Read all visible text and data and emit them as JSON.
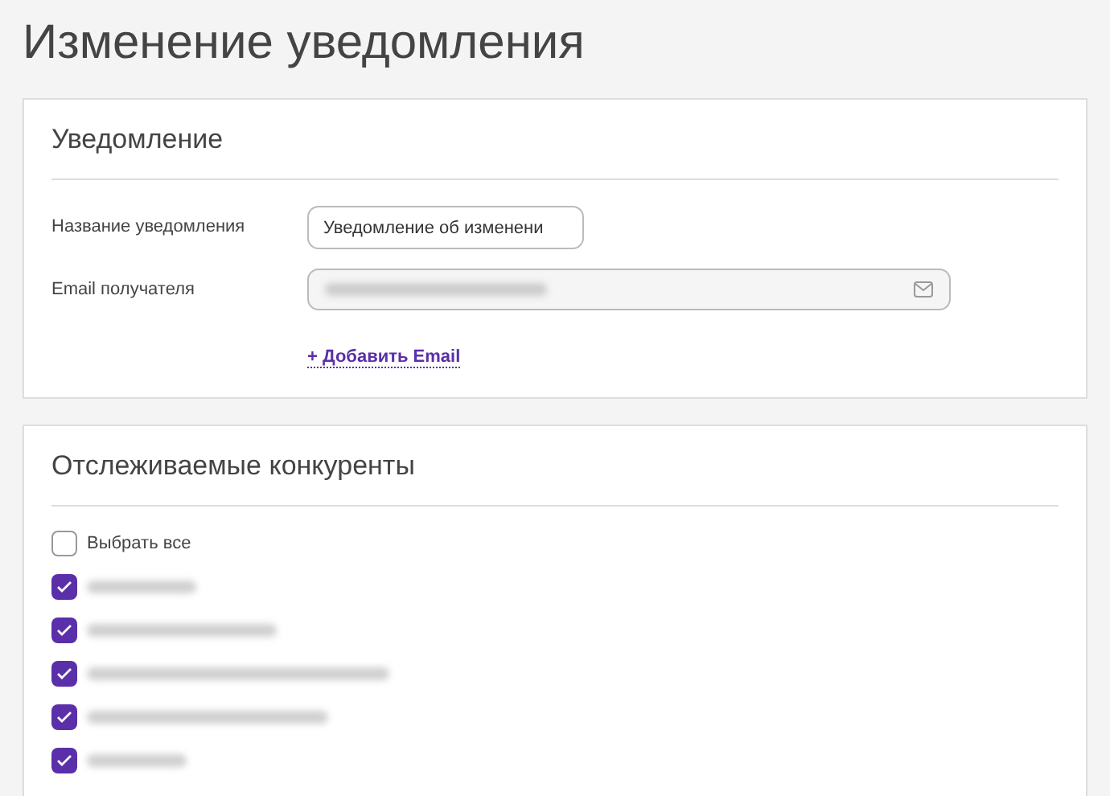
{
  "page_title": "Изменение уведомления",
  "notification": {
    "heading": "Уведомление",
    "name_label": "Название уведомления",
    "name_value": "Уведомление об изменени",
    "email_label": "Email получателя",
    "add_email": "+ Добавить Email"
  },
  "competitors": {
    "heading": "Отслеживаемые конкуренты",
    "select_all": {
      "label": "Выбрать все",
      "checked": false
    },
    "items": [
      {
        "checked": true
      },
      {
        "checked": true
      },
      {
        "checked": true
      },
      {
        "checked": true
      },
      {
        "checked": true
      }
    ]
  }
}
